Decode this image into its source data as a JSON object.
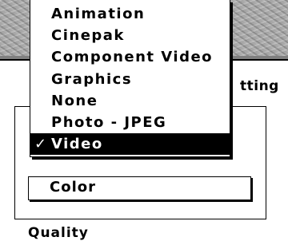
{
  "dialog": {
    "settings_partial": "tting",
    "quality_partial": "Quality",
    "color_popup_value": "Color"
  },
  "compressor_menu": {
    "items": [
      {
        "label": "Animation",
        "selected": false
      },
      {
        "label": "Cinepak",
        "selected": false
      },
      {
        "label": "Component Video",
        "selected": false
      },
      {
        "label": "Graphics",
        "selected": false
      },
      {
        "label": "None",
        "selected": false
      },
      {
        "label": "Photo - JPEG",
        "selected": false
      },
      {
        "label": "Video",
        "selected": true
      }
    ],
    "check_mark": "✓"
  },
  "colors": {
    "titlebar": "#a9a9a9",
    "highlight": "#000000"
  }
}
